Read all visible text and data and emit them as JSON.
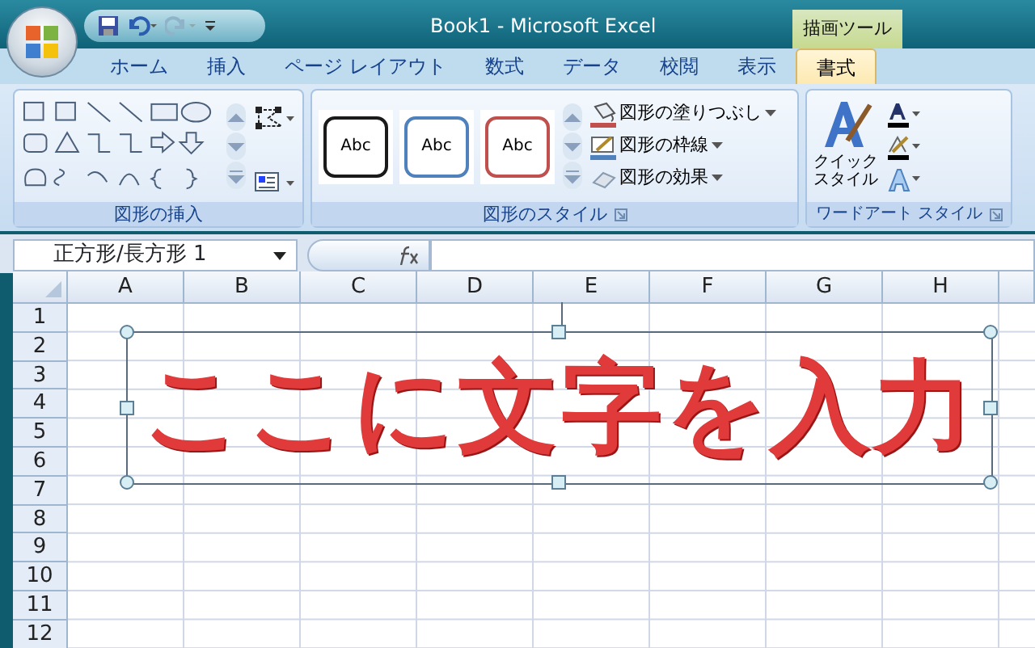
{
  "window": {
    "title": "Book1 - Microsoft Excel",
    "context_label": "描画ツール"
  },
  "tabs": [
    {
      "label": "ホーム",
      "selected": false
    },
    {
      "label": "挿入",
      "selected": false
    },
    {
      "label": "ページ レイアウト",
      "selected": false
    },
    {
      "label": "数式",
      "selected": false
    },
    {
      "label": "データ",
      "selected": false
    },
    {
      "label": "校閲",
      "selected": false
    },
    {
      "label": "表示",
      "selected": false
    },
    {
      "label": "書式",
      "selected": true
    }
  ],
  "ribbon": {
    "insert_group": {
      "label": "図形の挿入"
    },
    "style_group": {
      "label": "図形のスタイル",
      "samples": [
        {
          "label": "Abc",
          "color": "#1a1a1a"
        },
        {
          "label": "Abc",
          "color": "#4f81bd"
        },
        {
          "label": "Abc",
          "color": "#c0504d"
        }
      ],
      "commands": [
        {
          "label": "図形の塗りつぶし",
          "kind": "fill"
        },
        {
          "label": "図形の枠線",
          "kind": "outline"
        },
        {
          "label": "図形の効果",
          "kind": "effect"
        }
      ]
    },
    "wordart_group": {
      "label": "ワードアート スタイル",
      "quick_style_lines": [
        "クイック",
        "スタイル"
      ]
    }
  },
  "name_box": "正方形/長方形 1",
  "columns": [
    "A",
    "B",
    "C",
    "D",
    "E",
    "F",
    "G",
    "H"
  ],
  "rows": [
    "1",
    "2",
    "3",
    "4",
    "5",
    "6",
    "7",
    "8",
    "9",
    "10",
    "11",
    "12"
  ],
  "shape": {
    "text": "ここに文字を入力"
  }
}
